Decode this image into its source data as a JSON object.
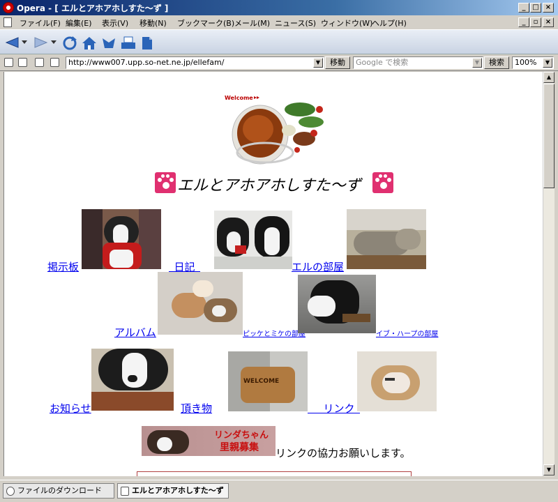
{
  "window": {
    "title": "Opera - [ エルとアホアホしすた～ず ]",
    "minimize": "_",
    "maximize": "□",
    "close": "×",
    "doc_minimize": "_",
    "doc_restore": "▫",
    "doc_close": "×"
  },
  "menu": [
    "ファイル(F)",
    "編集(E)",
    "表示(V)",
    "移動(N)",
    "ブックマーク(B)",
    "メール(M)",
    "ニュース(S)",
    "ウィンドウ(W)",
    "ヘルプ(H)"
  ],
  "address": {
    "url": "http://www007.upp.so-net.ne.jp/ellefam/",
    "go_label": "移動",
    "search_placeholder": "Google で検索",
    "search_label": "検索",
    "zoom": "100%"
  },
  "page": {
    "welcome_text": "Welcome",
    "title": "エルとアホアホしすた～ず",
    "links": {
      "bbs": "掲示板",
      "diary": "日記",
      "elle_room": "エルの部屋",
      "album": "アルバム",
      "pikke_mike": "ピッケとミケの部屋",
      "eve_harp": "イブ・ハープの部屋",
      "news": "お知らせ",
      "gifts": "頂き物",
      "link": "リンク"
    },
    "banner_text_1": "リンダちゃん",
    "banner_text_2": "里親募集",
    "cooperation_text": "リンクの協力お願いします。",
    "sign_text": "WELCOME"
  },
  "tabs": {
    "download": "ファイルのダウンロード",
    "current": "エルとアホアホしすた～ず"
  },
  "colors": {
    "link": "#0000ee",
    "title_bar": "#0a246a",
    "paw": "#e03070"
  }
}
